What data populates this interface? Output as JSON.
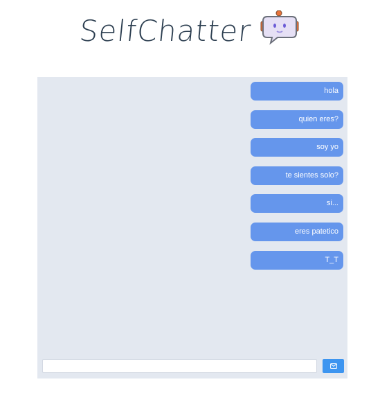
{
  "app": {
    "title": "SelfChatter"
  },
  "messages": [
    {
      "text": "hola"
    },
    {
      "text": "quien eres?"
    },
    {
      "text": "soy yo"
    },
    {
      "text": "te sientes solo?"
    },
    {
      "text": "si..."
    },
    {
      "text": "eres patetico"
    },
    {
      "text": "T_T"
    }
  ],
  "composer": {
    "value": "",
    "placeholder": "",
    "send_icon": "mail-icon"
  },
  "colors": {
    "bubble": "#6596ec",
    "panel": "#e3e8f0",
    "send_button": "#3d95f0",
    "title": "#2c3e50"
  }
}
